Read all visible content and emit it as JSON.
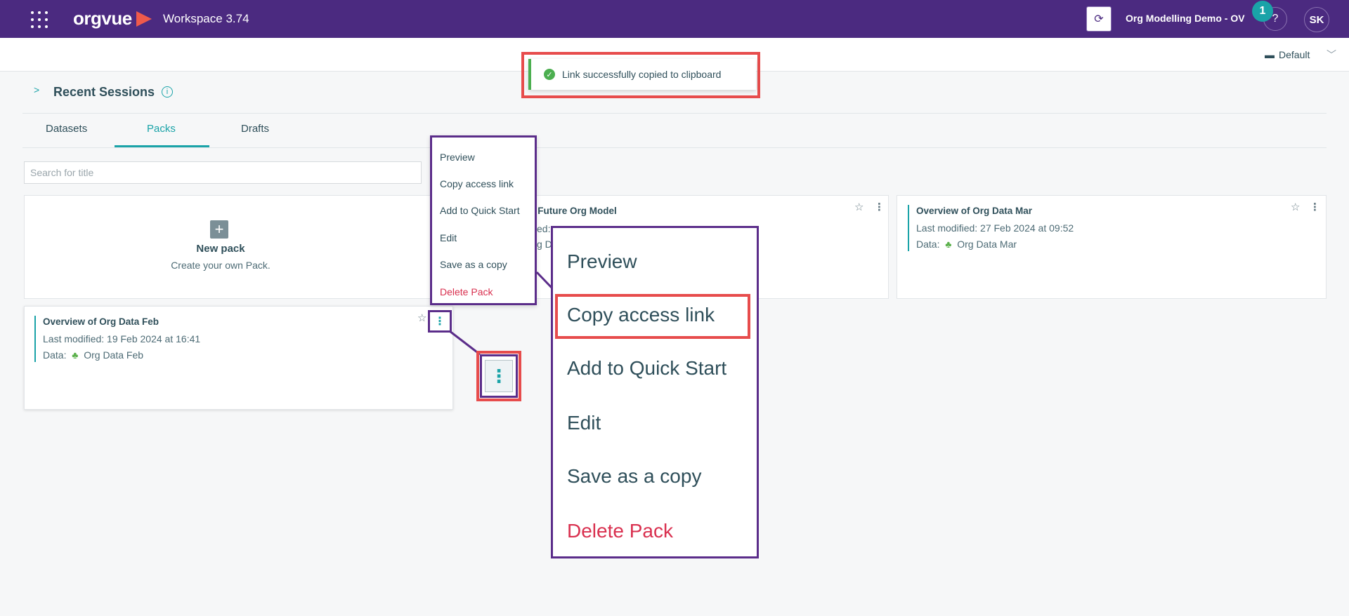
{
  "header": {
    "brand": "orgvue",
    "workspace": "Workspace  3.74",
    "org_name": "Org Modelling Demo - OV",
    "notification_count": "1",
    "help": "?",
    "avatar_initials": "SK"
  },
  "subbar": {
    "view_label": "Default"
  },
  "toast": {
    "message": "Link successfully copied to clipboard"
  },
  "recent": {
    "title": "Recent Sessions",
    "info": "i"
  },
  "tabs": [
    {
      "label": "Datasets"
    },
    {
      "label": "Packs"
    },
    {
      "label": "Drafts"
    }
  ],
  "active_tab": "Packs",
  "search": {
    "placeholder": "Search for title"
  },
  "new_pack": {
    "title": "New pack",
    "subtitle": "Create your own Pack."
  },
  "cards": [
    {
      "title": "f Future Org Model",
      "modified": "ed:",
      "data_label": "g D"
    },
    {
      "title": "Overview of Org Data Mar",
      "modified": "Last modified: 27 Feb 2024 at 09:52",
      "data_prefix": "Data:",
      "data_name": "Org Data Mar"
    },
    {
      "title": "Overview of Org Data Feb",
      "modified": "Last modified: 19 Feb 2024 at 16:41",
      "data_prefix": "Data:",
      "data_name": "Org Data Feb"
    }
  ],
  "context_menu": {
    "items": [
      "Preview",
      "Copy access link",
      "Add to Quick Start",
      "Edit",
      "Save as a copy",
      "Delete Pack"
    ]
  },
  "colors": {
    "header_bg": "#4b2a80",
    "accent": "#1aa3a8",
    "highlight_red": "#e74c4c",
    "callout_purple": "#5b2d8a",
    "danger": "#d9304f",
    "success": "#4caf50"
  }
}
